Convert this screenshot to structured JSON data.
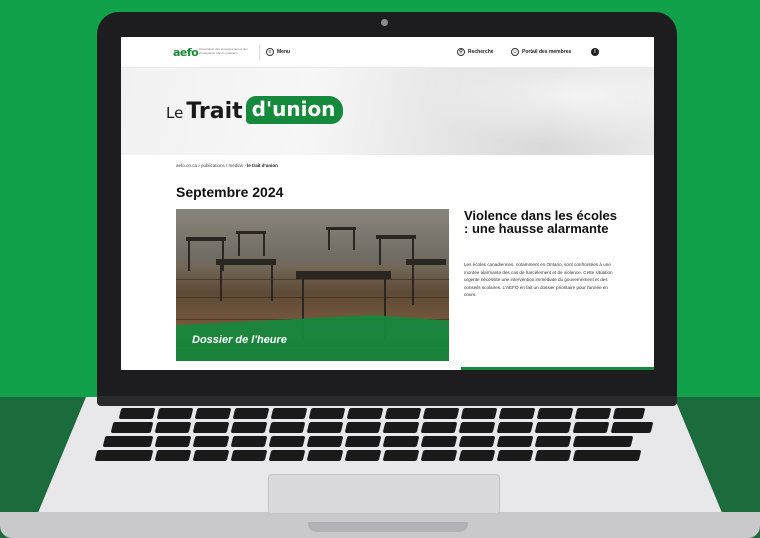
{
  "site": {
    "logo_text": "aefo",
    "logo_tagline": "Association des enseignantes et des enseignants franco-ontariens",
    "menu_label": "Menu",
    "search_label": "Recherche",
    "portal_label": "Portail des membres",
    "info_icon_glyph": "i"
  },
  "hero": {
    "brand_le": "Le",
    "brand_trait": "Trait",
    "brand_union": "d'union"
  },
  "breadcrumb": {
    "path": "aefo.on.ca › publications / médias › ",
    "current": "le trait d'union"
  },
  "page": {
    "title": "Septembre 2024"
  },
  "feature": {
    "caption": "Dossier de l'heure"
  },
  "article": {
    "title": "Violence dans les écoles : une hausse alarmante",
    "body": "Les écoles canadiennes, notamment en Ontario, sont confrontées à une montée alarmante des cas de harcèlement et de violence. Cette situation urgente nécessite une intervention immédiate du gouvernement et des conseils scolaires. L'AEFO en fait un dossier prioritaire pour l'année en cours."
  },
  "colors": {
    "accent_green": "#168a3c",
    "background_green": "#12a14b",
    "background_dark_green": "#1b6b3c"
  },
  "icons": {
    "menu": "menu-icon",
    "search": "search-icon",
    "portal": "user-icon",
    "info": "info-icon"
  }
}
